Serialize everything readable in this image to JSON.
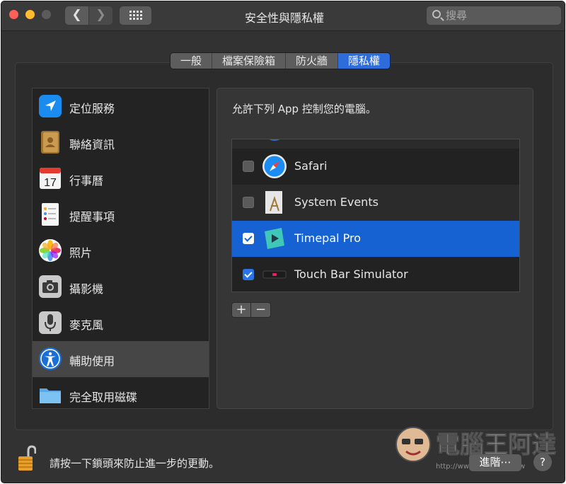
{
  "window": {
    "title": "安全性與隱私權",
    "search_placeholder": "搜尋"
  },
  "tabs": [
    {
      "label": "一般",
      "active": false
    },
    {
      "label": "檔案保險箱",
      "active": false
    },
    {
      "label": "防火牆",
      "active": false
    },
    {
      "label": "隱私權",
      "active": true
    }
  ],
  "sidebar": {
    "items": [
      {
        "label": "定位服務",
        "icon": "location-arrow-icon"
      },
      {
        "label": "聯絡資訊",
        "icon": "contacts-book-icon"
      },
      {
        "label": "行事曆",
        "icon": "calendar-icon",
        "day": "17"
      },
      {
        "label": "提醒事項",
        "icon": "reminders-icon"
      },
      {
        "label": "照片",
        "icon": "photos-icon"
      },
      {
        "label": "攝影機",
        "icon": "camera-icon"
      },
      {
        "label": "麥克風",
        "icon": "microphone-icon"
      },
      {
        "label": "輔助使用",
        "icon": "accessibility-icon",
        "selected": true
      },
      {
        "label": "完全取用磁碟",
        "icon": "folder-icon"
      }
    ]
  },
  "pane": {
    "description": "允許下列 App 控制您的電腦。",
    "apps": [
      {
        "name": "Safari",
        "checked": false,
        "icon": "safari-compass-icon"
      },
      {
        "name": "System Events",
        "checked": false,
        "icon": "system-events-icon"
      },
      {
        "name": "Timepal Pro",
        "checked": true,
        "selected": true,
        "icon": "timepal-pro-icon"
      },
      {
        "name": "Touch Bar Simulator",
        "checked": true,
        "icon": "touch-bar-simulator-icon"
      }
    ],
    "add_label": "+",
    "remove_label": "−"
  },
  "footer": {
    "lock_text": "請按一下鎖頭來防止進一步的更動。",
    "advanced_label": "進階⋯",
    "help_label": "?"
  },
  "watermark": {
    "text": "電腦王阿達",
    "url": "http://www.kocpc.com.tw"
  },
  "colors": {
    "accent": "#1762d3",
    "tab_active": "#2e6bdb",
    "background": "#323232"
  }
}
